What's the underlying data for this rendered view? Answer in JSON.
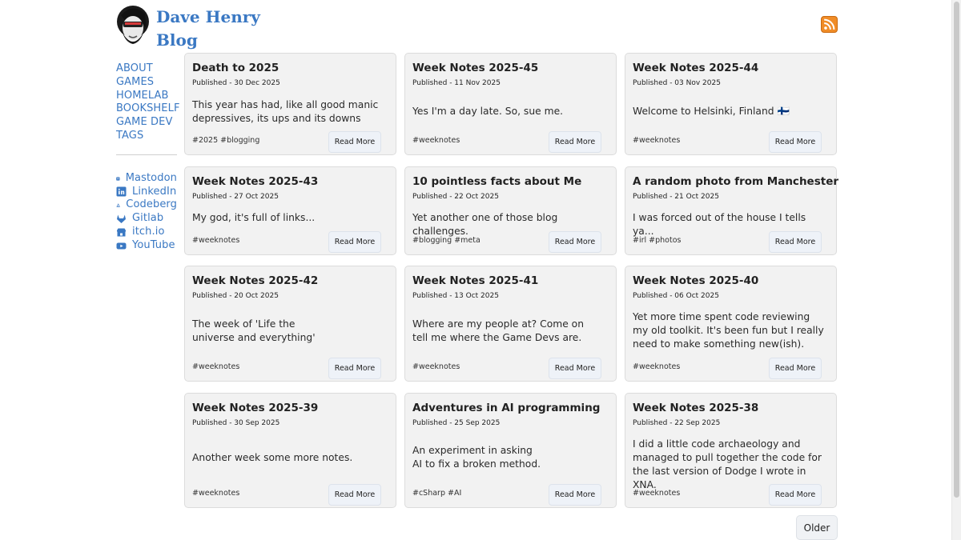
{
  "site": {
    "title_line1": "Dave Henry",
    "title_line2": "Blog",
    "avatar_icon": "avatar-portrait-icon",
    "rss_icon": "rss-feed-icon",
    "accent": "#3a78c3"
  },
  "nav": [
    "ABOUT",
    "GAMES",
    "HOMELAB",
    "BOOKSHELF",
    "GAME DEV",
    "TAGS"
  ],
  "social": [
    {
      "label": "Mastodon",
      "icon": "mastodon-icon"
    },
    {
      "label": "LinkedIn",
      "icon": "linkedin-icon"
    },
    {
      "label": "Codeberg",
      "icon": "codeberg-icon"
    },
    {
      "label": "Gitlab",
      "icon": "gitlab-icon"
    },
    {
      "label": "itch.io",
      "icon": "itchio-icon"
    },
    {
      "label": "YouTube",
      "icon": "youtube-icon"
    }
  ],
  "read_more_label": "Read More",
  "older_label": "Older",
  "posts": [
    {
      "title": "Death to 2025",
      "date": "Published - 30 Dec 2025",
      "excerpt": [
        "This year has had, like all good manic",
        "depressives, its ups and its downs"
      ],
      "tags": "#2025 #blogging"
    },
    {
      "title": "Week Notes 2025-45",
      "date": "Published - 11 Nov 2025",
      "excerpt": [
        "Yes I'm a day late. So, sue me."
      ],
      "tags": "#weeknotes"
    },
    {
      "title": "Week Notes 2025-44",
      "date": "Published - 03 Nov 2025",
      "excerpt": [
        "Welcome to Helsinki, Finland 🇫🇮"
      ],
      "tags": "#weeknotes"
    },
    {
      "title": "Week Notes 2025-43",
      "date": "Published - 27 Oct 2025",
      "excerpt": [
        "My god, it's full of links..."
      ],
      "tags": "#weeknotes"
    },
    {
      "title": "10 pointless facts about Me",
      "date": "Published - 22 Oct 2025",
      "excerpt": [
        "Yet another one of those blog challenges."
      ],
      "tags": "#blogging #meta"
    },
    {
      "title": "A random photo from Manchester",
      "date": "Published - 21 Oct 2025",
      "excerpt": [
        "I was forced out of the house I tells ya..."
      ],
      "tags": "#irl #photos"
    },
    {
      "title": "Week Notes 2025-42",
      "date": "Published - 20 Oct 2025",
      "excerpt": [
        "The week of 'Life the",
        "universe and everything'"
      ],
      "tags": "#weeknotes"
    },
    {
      "title": "Week Notes 2025-41",
      "date": "Published - 13 Oct 2025",
      "excerpt": [
        "Where are my people at? Come on",
        "tell me where the Game Devs are."
      ],
      "tags": "#weeknotes"
    },
    {
      "title": "Week Notes 2025-40",
      "date": "Published - 06 Oct 2025",
      "excerpt": [
        "Yet more time spent code reviewing",
        "my old toolkit. It's been fun but I really",
        "need to make something new(ish)."
      ],
      "tags": "#weeknotes"
    },
    {
      "title": "Week Notes 2025-39",
      "date": "Published - 30 Sep 2025",
      "excerpt": [
        "Another week some more notes."
      ],
      "tags": "#weeknotes"
    },
    {
      "title": "Adventures in AI programming",
      "date": "Published - 25 Sep 2025",
      "excerpt": [
        "An experiment in asking",
        "AI to fix a broken method."
      ],
      "tags": "#cSharp #AI"
    },
    {
      "title": "Week Notes 2025-38",
      "date": "Published - 22 Sep 2025",
      "excerpt": [
        "I did a little code archaeology and",
        "managed to pull together the code for",
        "the last version of Dodge I wrote in XNA."
      ],
      "tags": "#weeknotes"
    }
  ]
}
